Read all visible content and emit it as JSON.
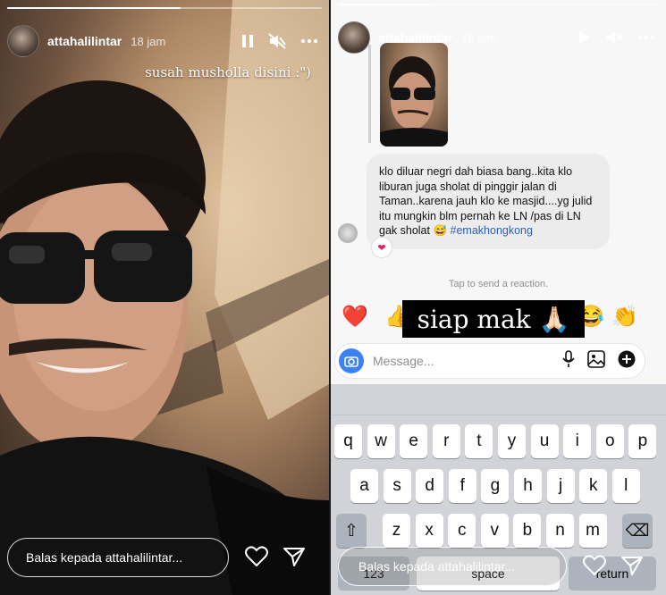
{
  "left_story": {
    "username": "attahalilintar",
    "time": "18 jam",
    "caption": "susah musholla disini :\")",
    "reply_placeholder": "Balas kepada attahalilintar...",
    "icons": [
      "pause-icon",
      "mute-icon",
      "more-icon",
      "heart-icon",
      "send-icon"
    ],
    "progress": 0.55
  },
  "right_story": {
    "username": "attahalilintar",
    "time": "18 jam",
    "reply_placeholder": "Balas kepada attahalilintar...",
    "icons": [
      "play-icon",
      "mute-icon",
      "more-icon",
      "heart-icon",
      "send-icon"
    ],
    "progress": 0.3,
    "comment": {
      "text": "klo diluar negri  dah biasa bang..kita klo liburan juga sholat di pinggir jalan di Taman..karena jauh klo ke masjid....yg julid itu  mungkin blm pernah ke LN /pas di LN gak sholat 😅",
      "hashtag": "#emakhongkong",
      "reaction": "❤"
    },
    "tap_hint": "Tap to send a reaction.",
    "reactions": [
      "❤️",
      "👍",
      "😂",
      "👏"
    ],
    "sticker_text": "siap mak 🙏🏻",
    "message_placeholder": "Message...",
    "keyboard": {
      "row1": [
        "q",
        "w",
        "e",
        "r",
        "t",
        "y",
        "u",
        "i",
        "o",
        "p"
      ],
      "row2": [
        "a",
        "s",
        "d",
        "f",
        "g",
        "h",
        "j",
        "k",
        "l"
      ],
      "row3": [
        "z",
        "x",
        "c",
        "v",
        "b",
        "n",
        "m"
      ],
      "shift": "⇧",
      "delete": "⌫",
      "numbers": "123",
      "space": "space",
      "return": "return"
    }
  },
  "colors": {
    "accent": "#3b82f6",
    "hashtag": "#2d5fb8",
    "heart": "#e0245e"
  }
}
